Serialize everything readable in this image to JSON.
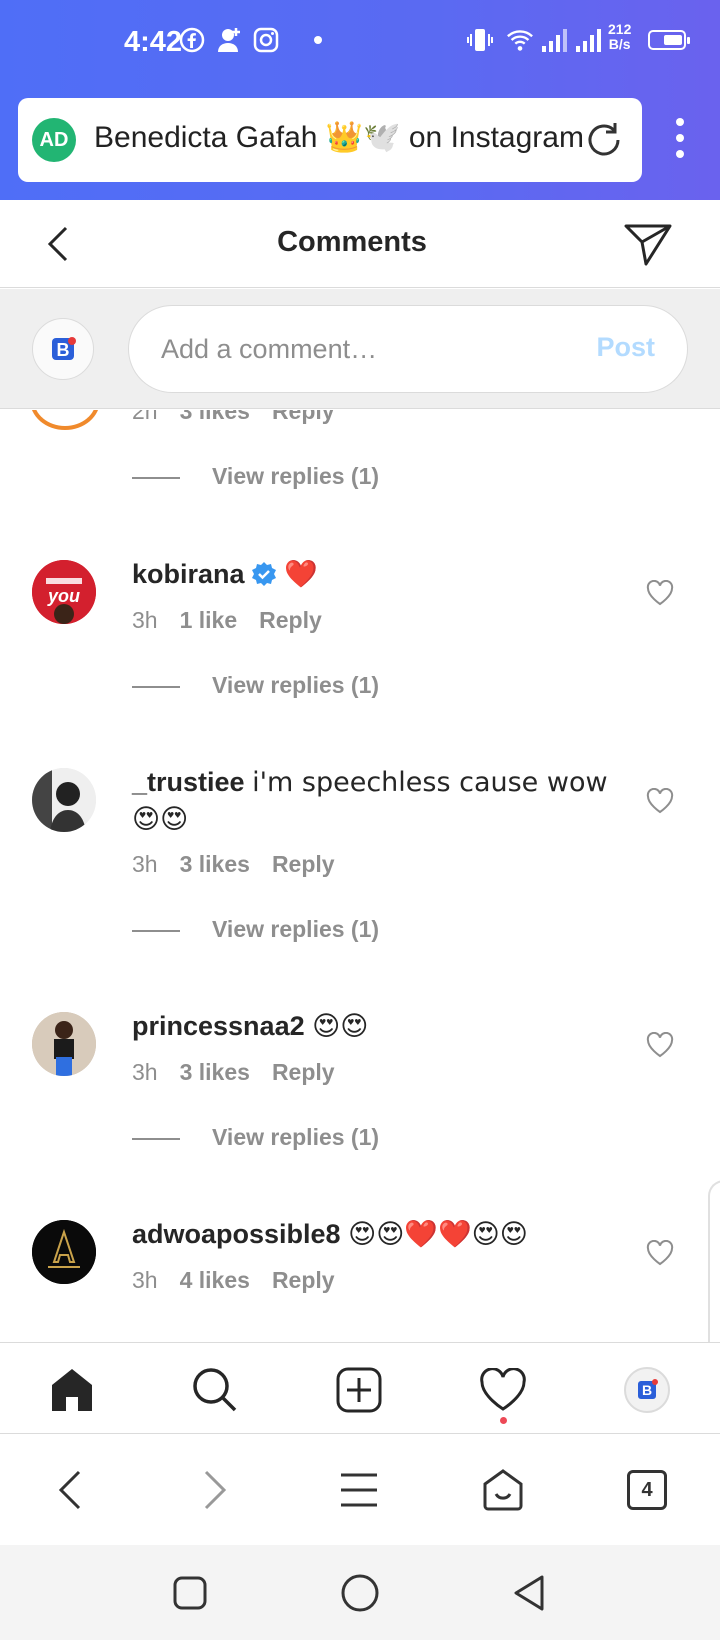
{
  "status_bar": {
    "time": "4:42",
    "net_speed_value": "212",
    "net_speed_unit": "B/s",
    "icons": [
      "facebook-icon",
      "add-contact-icon",
      "instagram-icon",
      "vibrate-icon",
      "wifi-icon",
      "signal-icon",
      "battery-icon"
    ]
  },
  "browser": {
    "ad_badge": "AD",
    "page_title": "Benedicta Gafah 👑🕊️ on Instagram",
    "tab_count": "4"
  },
  "header": {
    "title": "Comments"
  },
  "comment_input": {
    "placeholder": "Add a comment…",
    "post_label": "Post"
  },
  "colors": {
    "accent_gradient_start": "#4f6ef7",
    "accent_gradient_end": "#6a62ee",
    "post_disabled": "#b3dbff",
    "muted_text": "#8e8e8e",
    "notification_dot": "#ed4956",
    "verified_blue": "#3897f0"
  },
  "partial_comment": {
    "time": "2h",
    "likes": "3 likes",
    "reply": "Reply",
    "view_replies": "View replies (1)"
  },
  "comments": [
    {
      "username": "kobirana",
      "verified": true,
      "text": "❤️",
      "time": "3h",
      "likes": "1 like",
      "reply": "Reply",
      "view_replies": "View replies (1)"
    },
    {
      "username": "_trustiee",
      "verified": false,
      "text": "i'm speechless cause wow😍😍",
      "time": "3h",
      "likes": "3 likes",
      "reply": "Reply",
      "view_replies": "View replies (1)"
    },
    {
      "username": "princessnaa2",
      "verified": false,
      "text": "😍😍",
      "time": "3h",
      "likes": "3 likes",
      "reply": "Reply",
      "view_replies": "View replies (1)"
    },
    {
      "username": "adwoapossible8",
      "verified": false,
      "text": "😍😍❤️❤️😍😍",
      "time": "3h",
      "likes": "4 likes",
      "reply": "Reply"
    }
  ]
}
